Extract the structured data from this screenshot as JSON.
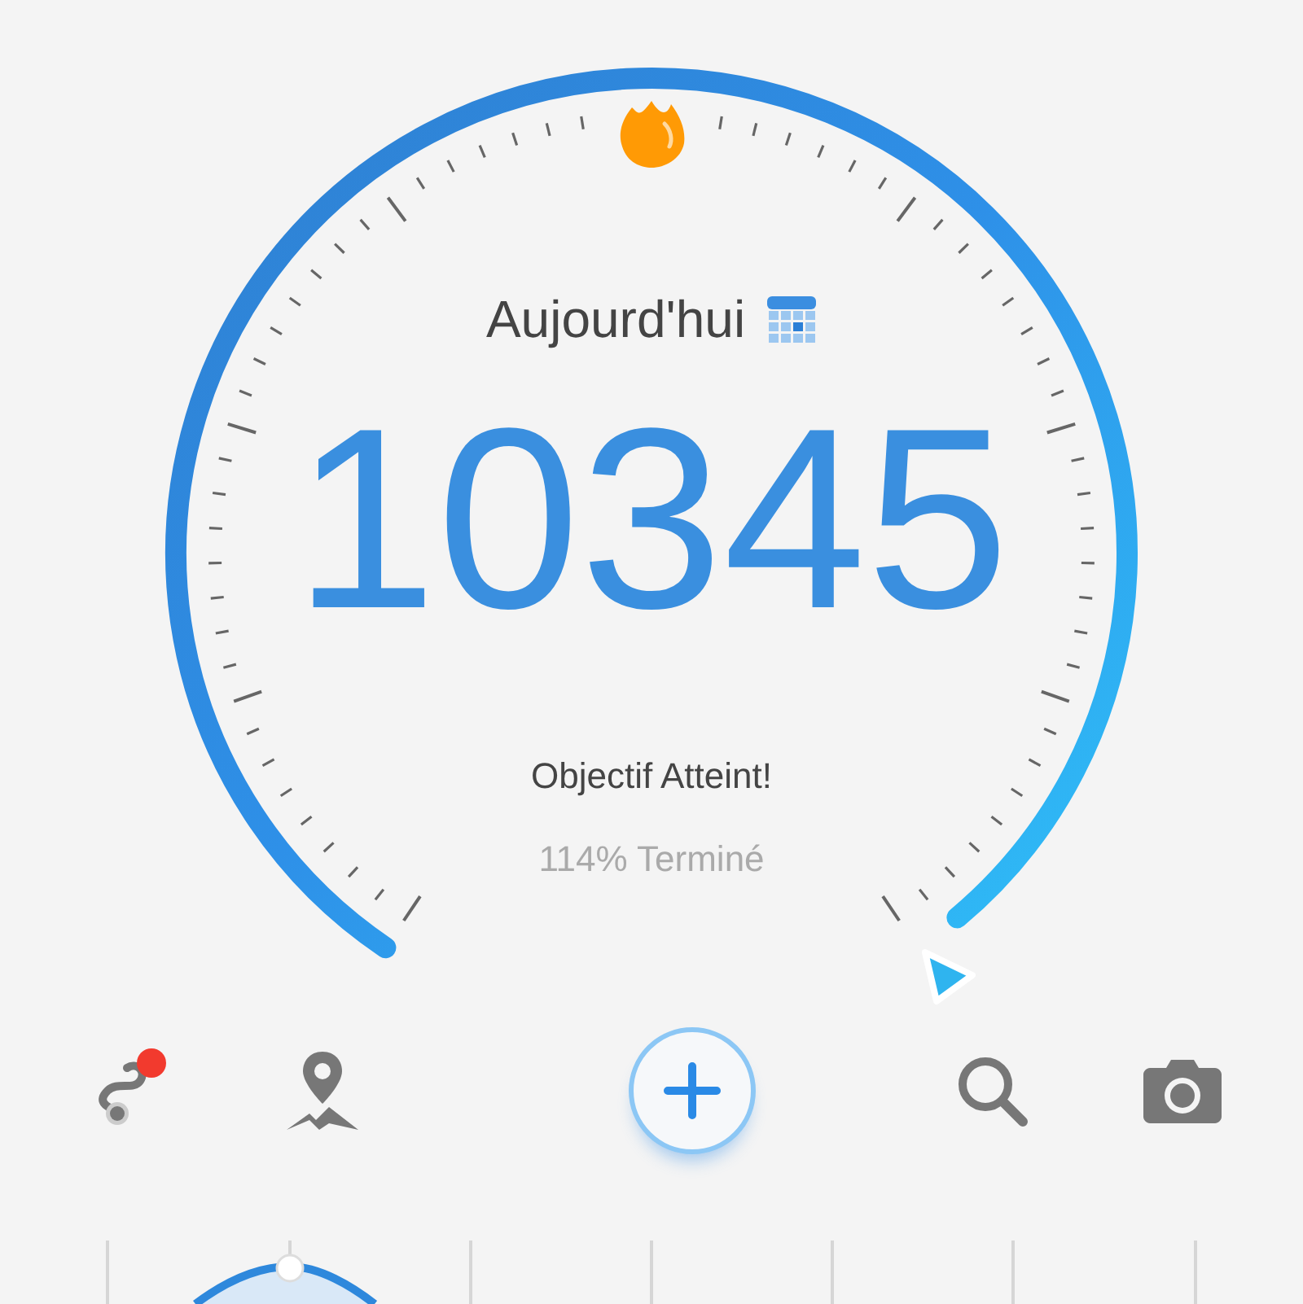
{
  "header": {
    "title": "Aujourd'hui"
  },
  "steps": {
    "count": "10345",
    "status": "Objectif Atteint!",
    "progress_text": "114% Terminé"
  },
  "toolbar": {
    "route_notification": true
  }
}
